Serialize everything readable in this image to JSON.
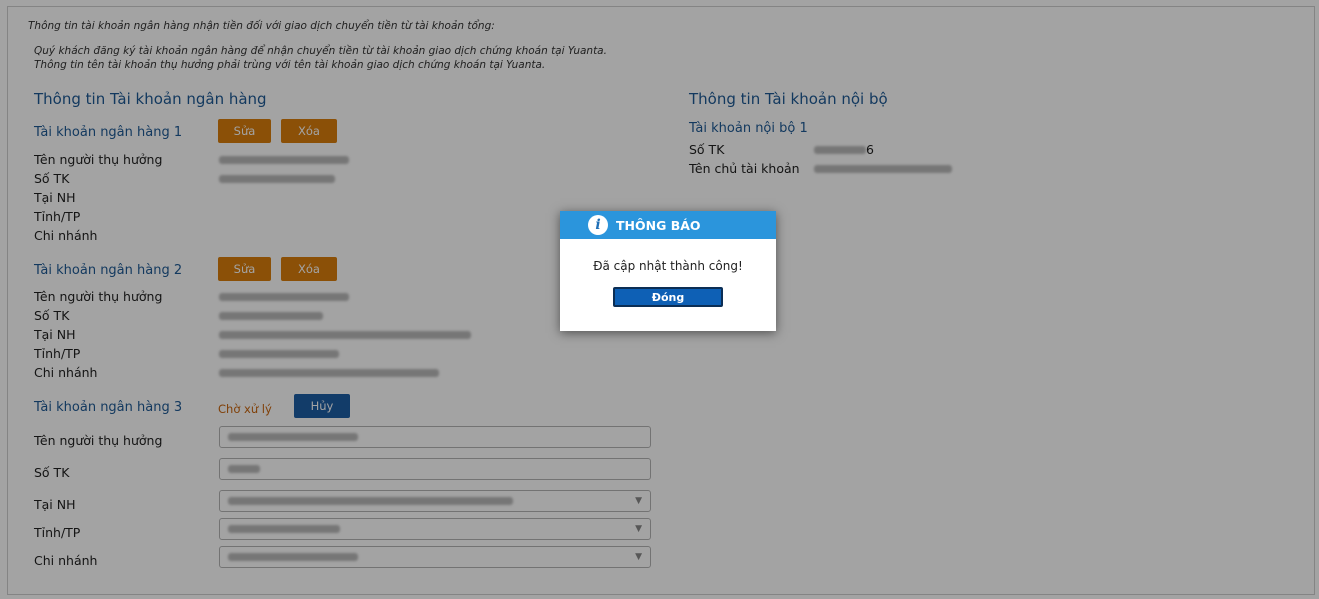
{
  "notes": {
    "line1": "Thông tin tài khoản ngân hàng nhận tiền đối với giao dịch chuyển tiền từ tài khoản tổng:",
    "line2": "Quý khách đăng ký tài khoản ngân hàng để nhận chuyển tiền từ tài khoản giao dịch chứng khoán tại Yuanta.",
    "line3": "Thông tin tên tài khoản thụ hưởng phải trùng với tên tài khoản giao dịch chứng khoán tại Yuanta."
  },
  "bank": {
    "title": "Thông tin Tài khoản ngân hàng",
    "labels": {
      "beneficiary": "Tên người thụ hưởng",
      "account_no": "Số TK",
      "bank": "Tại NH",
      "province": "Tỉnh/TP",
      "branch": "Chi nhánh"
    },
    "account1": {
      "title": "Tài khoản ngân hàng 1",
      "edit": "Sửa",
      "delete": "Xóa"
    },
    "account2": {
      "title": "Tài khoản ngân hàng 2",
      "edit": "Sửa",
      "delete": "Xóa"
    },
    "account3": {
      "title": "Tài khoản ngân hàng 3",
      "status": "Chờ xử lý",
      "cancel": "Hủy"
    }
  },
  "internal": {
    "title": "Thông tin Tài khoản nội bộ",
    "account_title": "Tài khoản nội bộ 1",
    "account_no_label": "Số TK",
    "account_no_suffix": "6",
    "owner_label": "Tên chủ tài khoản"
  },
  "dialog": {
    "title": "THÔNG BÁO",
    "message": "Đã cập nhật thành công!",
    "close": "Đóng"
  },
  "icons": {
    "dialog_icon": "info-icon",
    "select_caret": "chevron-down-icon"
  },
  "colors": {
    "primary_blue": "#1e5a95",
    "orange": "#d97d0b",
    "dialog_header": "#2b95dc"
  }
}
